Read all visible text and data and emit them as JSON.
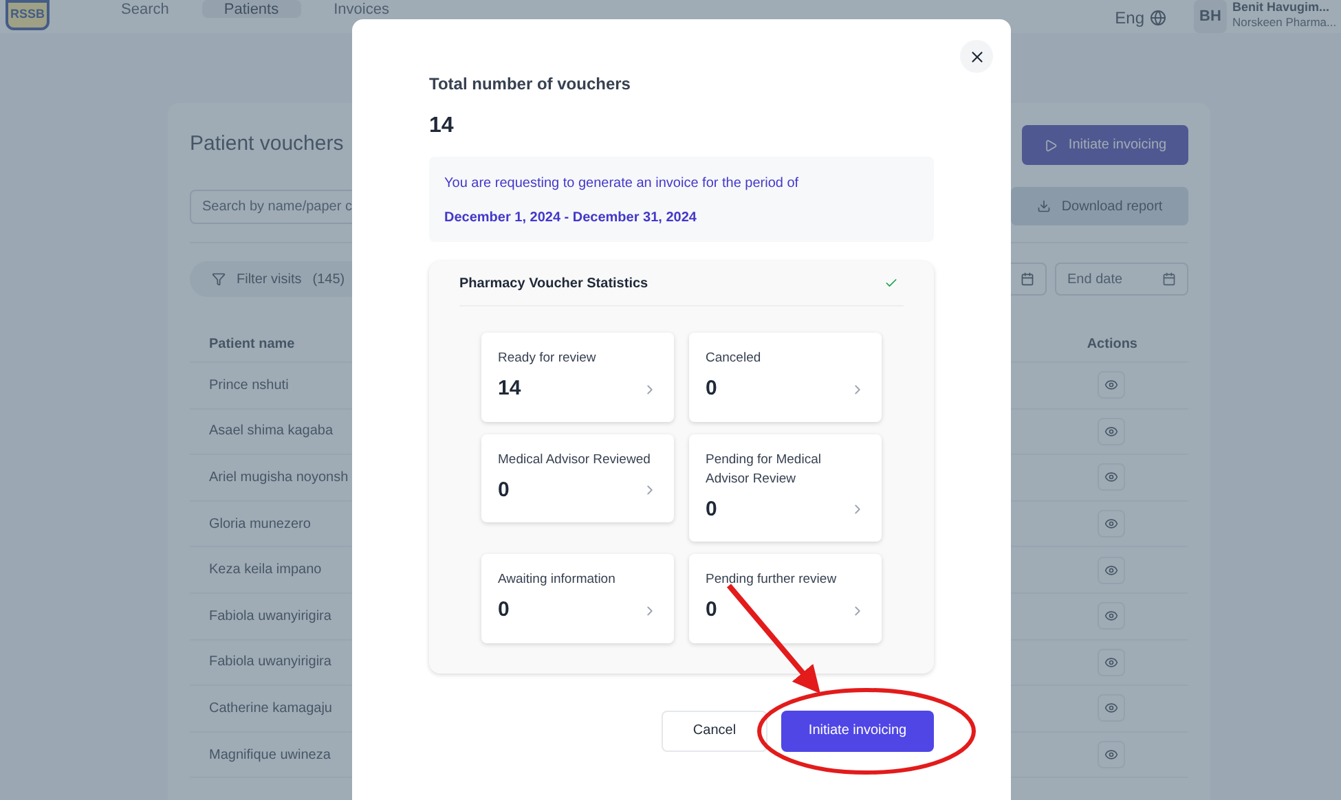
{
  "nav": {
    "logo": "RSSB",
    "items": [
      {
        "label": "Search",
        "selected": false
      },
      {
        "label": "Patients",
        "selected": true
      },
      {
        "label": "Invoices",
        "selected": false
      }
    ],
    "language": "Eng",
    "user": {
      "initials": "BH",
      "name": "Benit Havugim...",
      "org": "Norskeen Pharma..."
    }
  },
  "page": {
    "title": "Patient vouchers",
    "initiate_button": "Initiate invoicing",
    "search": {
      "placeholder": "Search by name/paper c"
    },
    "download_button": "Download report",
    "filter": {
      "label": "Filter visits",
      "count": "(145)"
    },
    "end_date": {
      "placeholder": "End date"
    },
    "table": {
      "columns": [
        "Patient name",
        "Actions"
      ],
      "rows": [
        {
          "patient_name": "Prince nshuti"
        },
        {
          "patient_name": "Asael shima kagaba"
        },
        {
          "patient_name": "Ariel mugisha noyonsh"
        },
        {
          "patient_name": "Gloria munezero"
        },
        {
          "patient_name": "Keza keila impano"
        },
        {
          "patient_name": "Fabiola uwanyirigira"
        },
        {
          "patient_name": "Fabiola uwanyirigira"
        },
        {
          "patient_name": "Catherine kamagaju"
        },
        {
          "patient_name": "Magnifique uwineza"
        }
      ]
    }
  },
  "modal": {
    "total_label": "Total number of vouchers",
    "total": "14",
    "info": "You are requesting to generate an invoice for the period of",
    "period": "December 1, 2024 - December 31, 2024",
    "stats": {
      "title": "Pharmacy Voucher Statistics",
      "complete": true,
      "cards": [
        {
          "label": "Ready for review",
          "value": "14"
        },
        {
          "label": "Canceled",
          "value": "0"
        },
        {
          "label": "Medical Advisor Reviewed",
          "value": "0"
        },
        {
          "label": "Pending for Medical Advisor Review",
          "value": "0"
        },
        {
          "label": "Awaiting information",
          "value": "0"
        },
        {
          "label": "Pending further review",
          "value": "0"
        }
      ]
    },
    "cancel": "Cancel",
    "confirm": "Initiate invoicing"
  }
}
